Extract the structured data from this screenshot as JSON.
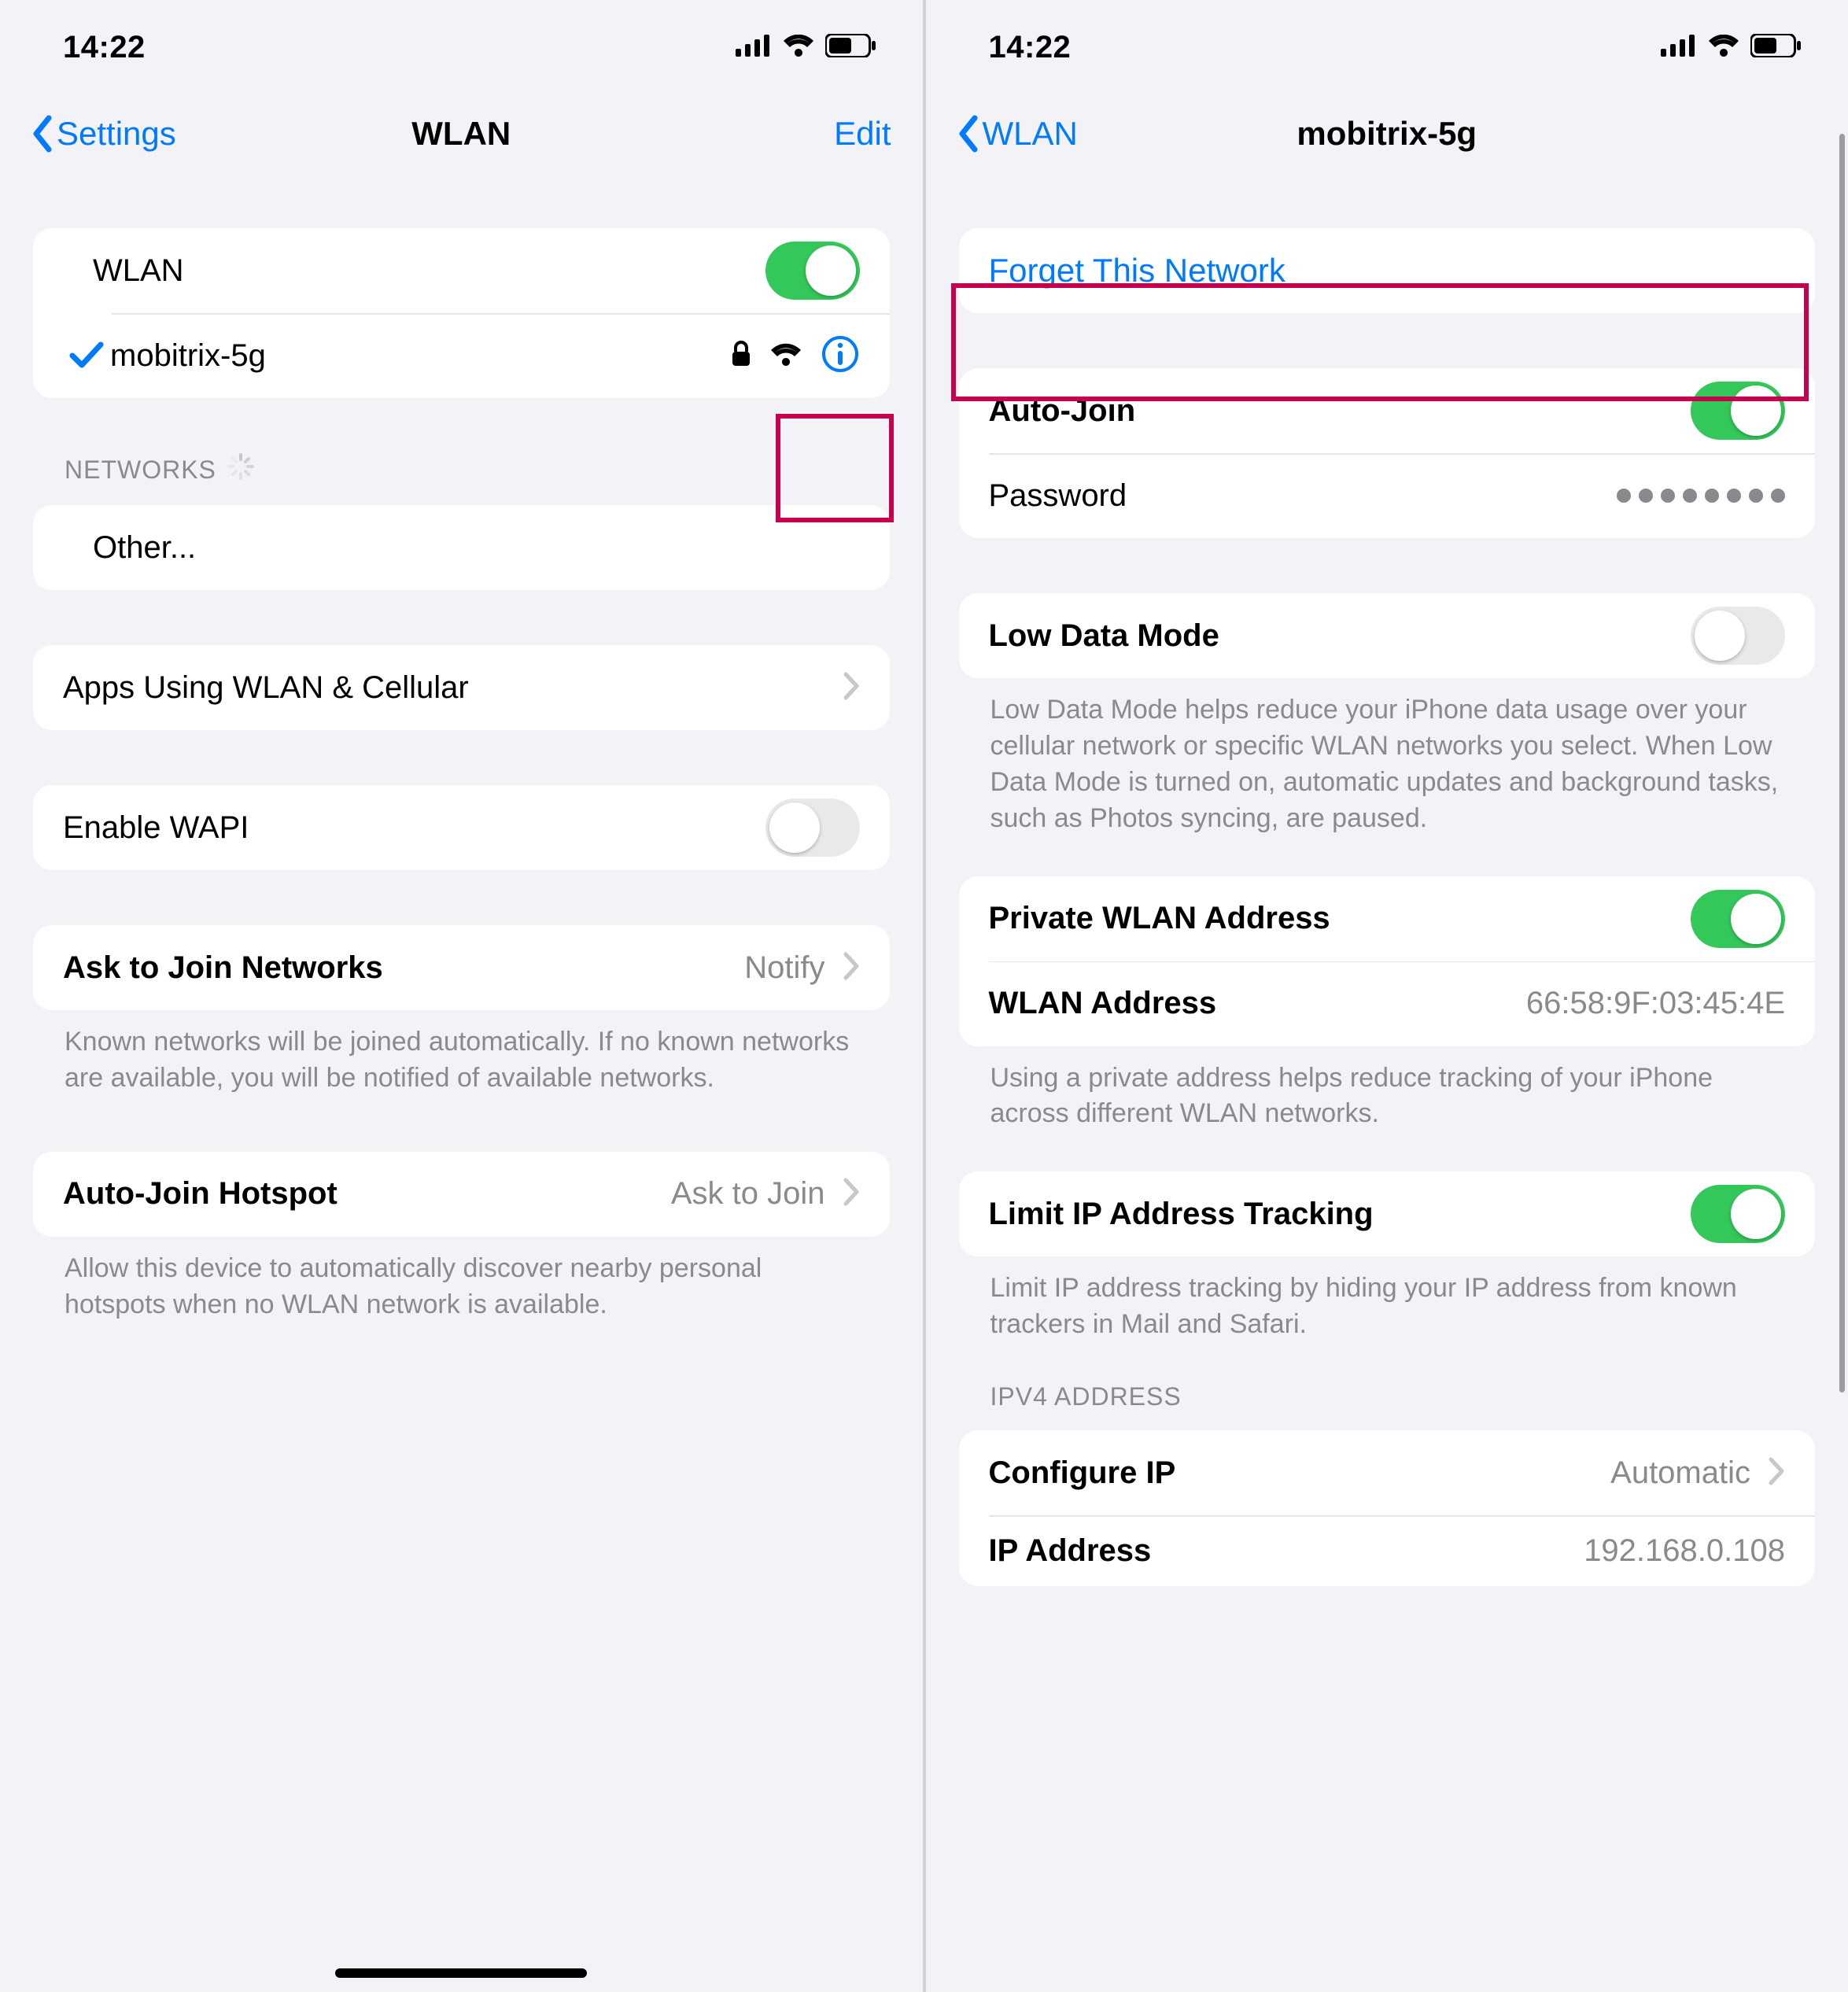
{
  "status": {
    "time": "14:22"
  },
  "left": {
    "title": "WLAN",
    "back": "Settings",
    "edit": "Edit",
    "wlan_label": "WLAN",
    "wlan_on": true,
    "connected_network": "mobitrix-5g",
    "networks_header": "NETWORKS",
    "other_label": "Other...",
    "apps_label": "Apps Using WLAN & Cellular",
    "enable_wapi_label": "Enable WAPI",
    "enable_wapi_on": false,
    "ask_join_label": "Ask to Join Networks",
    "ask_join_value": "Notify",
    "ask_join_footer": "Known networks will be joined automatically. If no known networks are available, you will be notified of available networks.",
    "auto_hotspot_label": "Auto-Join Hotspot",
    "auto_hotspot_value": "Ask to Join",
    "auto_hotspot_footer": "Allow this device to automatically discover nearby personal hotspots when no WLAN network is available."
  },
  "right": {
    "title": "mobitrix-5g",
    "back": "WLAN",
    "forget_label": "Forget This Network",
    "autojoin_label": "Auto-Join",
    "autojoin_on": true,
    "password_label": "Password",
    "password_dots": 8,
    "lowdata_label": "Low Data Mode",
    "lowdata_on": false,
    "lowdata_footer": "Low Data Mode helps reduce your iPhone data usage over your cellular network or specific WLAN networks you select. When Low Data Mode is turned on, automatic updates and background tasks, such as Photos syncing, are paused.",
    "private_addr_label": "Private WLAN Address",
    "private_addr_on": true,
    "wlan_addr_label": "WLAN Address",
    "wlan_addr_value": "66:58:9F:03:45:4E",
    "private_footer": "Using a private address helps reduce tracking of your iPhone across different WLAN networks.",
    "limit_ip_label": "Limit IP Address Tracking",
    "limit_ip_on": true,
    "limit_ip_footer": "Limit IP address tracking by hiding your IP address from known trackers in Mail and Safari.",
    "ipv4_header": "IPV4 ADDRESS",
    "configure_ip_label": "Configure IP",
    "configure_ip_value": "Automatic",
    "ip_addr_label": "IP Address",
    "ip_addr_value": "192.168.0.108"
  }
}
